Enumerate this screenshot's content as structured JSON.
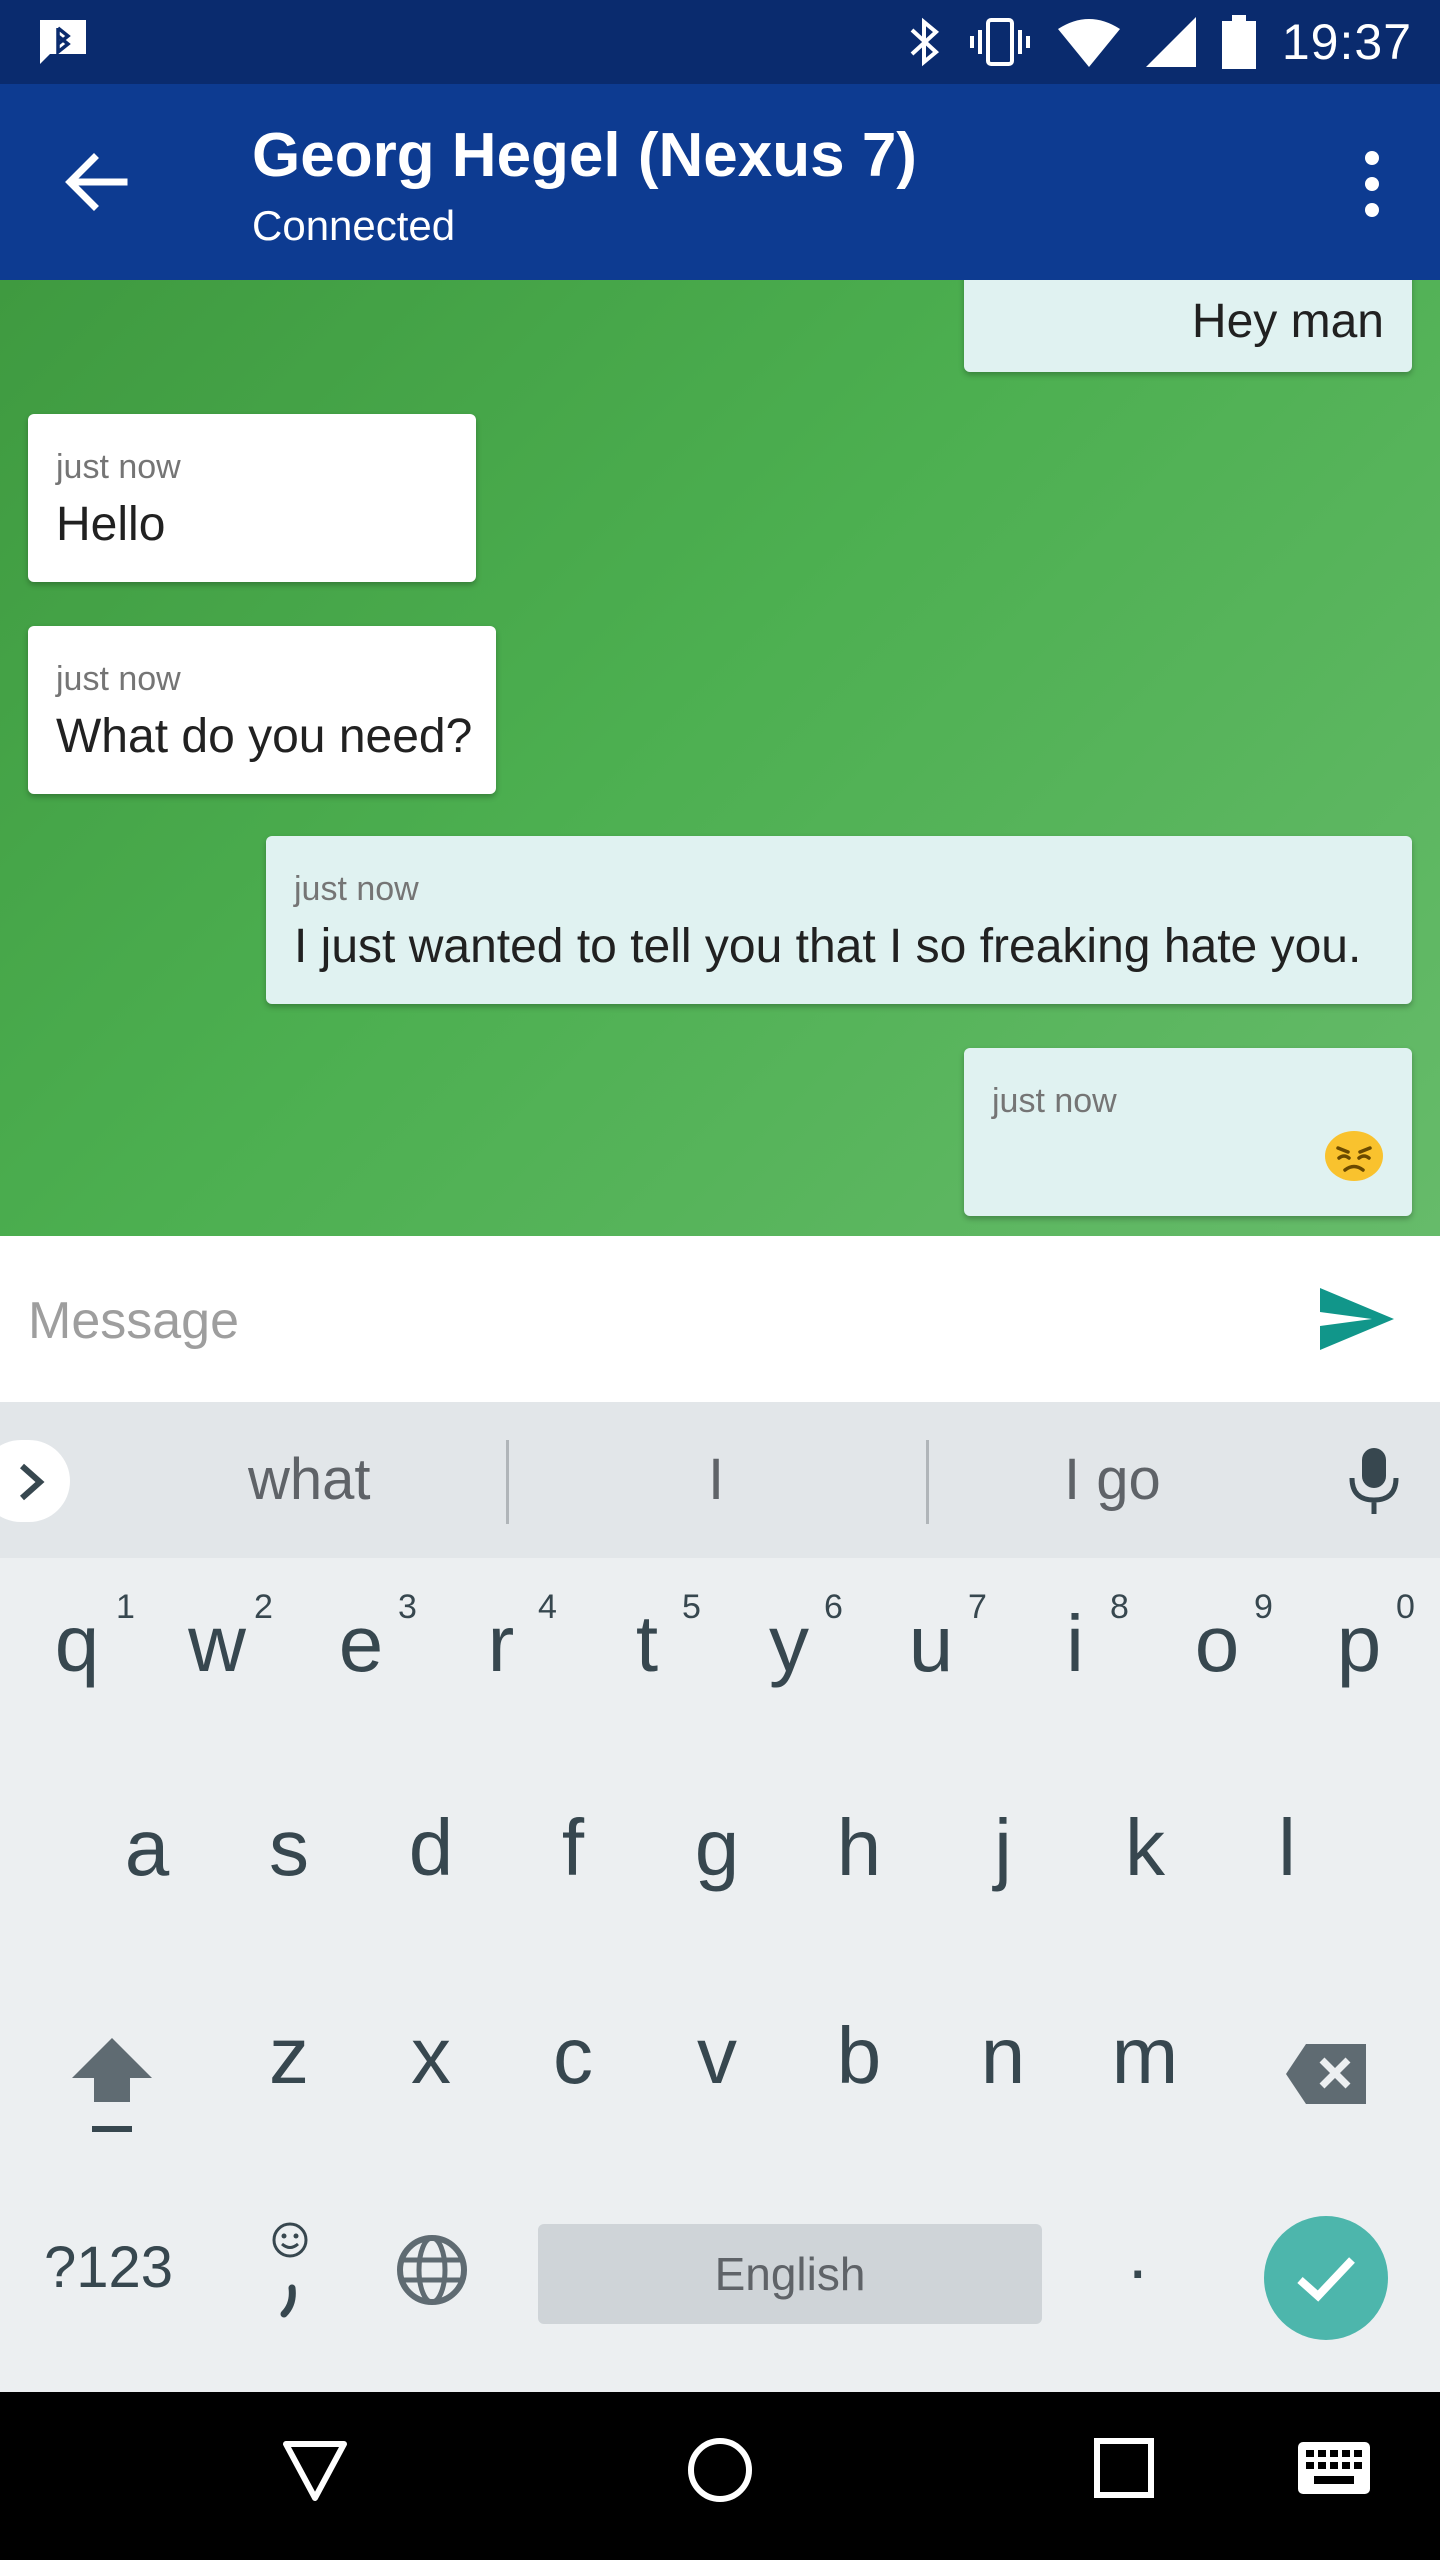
{
  "status_bar": {
    "time": "19:37",
    "icons": [
      "bluetooth-notification-icon",
      "bluetooth-icon",
      "vibrate-icon",
      "wifi-icon",
      "cell-signal-icon",
      "battery-icon"
    ]
  },
  "app_bar": {
    "title": "Georg Hegel  (Nexus 7)",
    "subtitle": "Connected",
    "background": "#0d3b91"
  },
  "messages": [
    {
      "direction": "outgoing",
      "time": "",
      "text": "Hey man"
    },
    {
      "direction": "incoming",
      "time": "just now",
      "text": "Hello"
    },
    {
      "direction": "incoming",
      "time": "just now",
      "text": "What do you need?"
    },
    {
      "direction": "outgoing",
      "time": "just now",
      "text": "I just wanted to tell you that I so freaking hate you."
    },
    {
      "direction": "outgoing",
      "time": "just now",
      "text": "",
      "emoji": "angry-face-emoji"
    }
  ],
  "composer": {
    "placeholder": "Message",
    "value": ""
  },
  "keyboard": {
    "suggestions": [
      "what",
      "I",
      "I go"
    ],
    "row1": [
      "q",
      "w",
      "e",
      "r",
      "t",
      "y",
      "u",
      "i",
      "o",
      "p"
    ],
    "row1_hints": [
      "1",
      "2",
      "3",
      "4",
      "5",
      "6",
      "7",
      "8",
      "9",
      "0"
    ],
    "row2": [
      "a",
      "s",
      "d",
      "f",
      "g",
      "h",
      "j",
      "k",
      "l"
    ],
    "row3": [
      "z",
      "x",
      "c",
      "v",
      "b",
      "n",
      "m"
    ],
    "symbols_label": "?123",
    "space_label": "English",
    "period_label": ".",
    "accent": "#4db6ac"
  }
}
